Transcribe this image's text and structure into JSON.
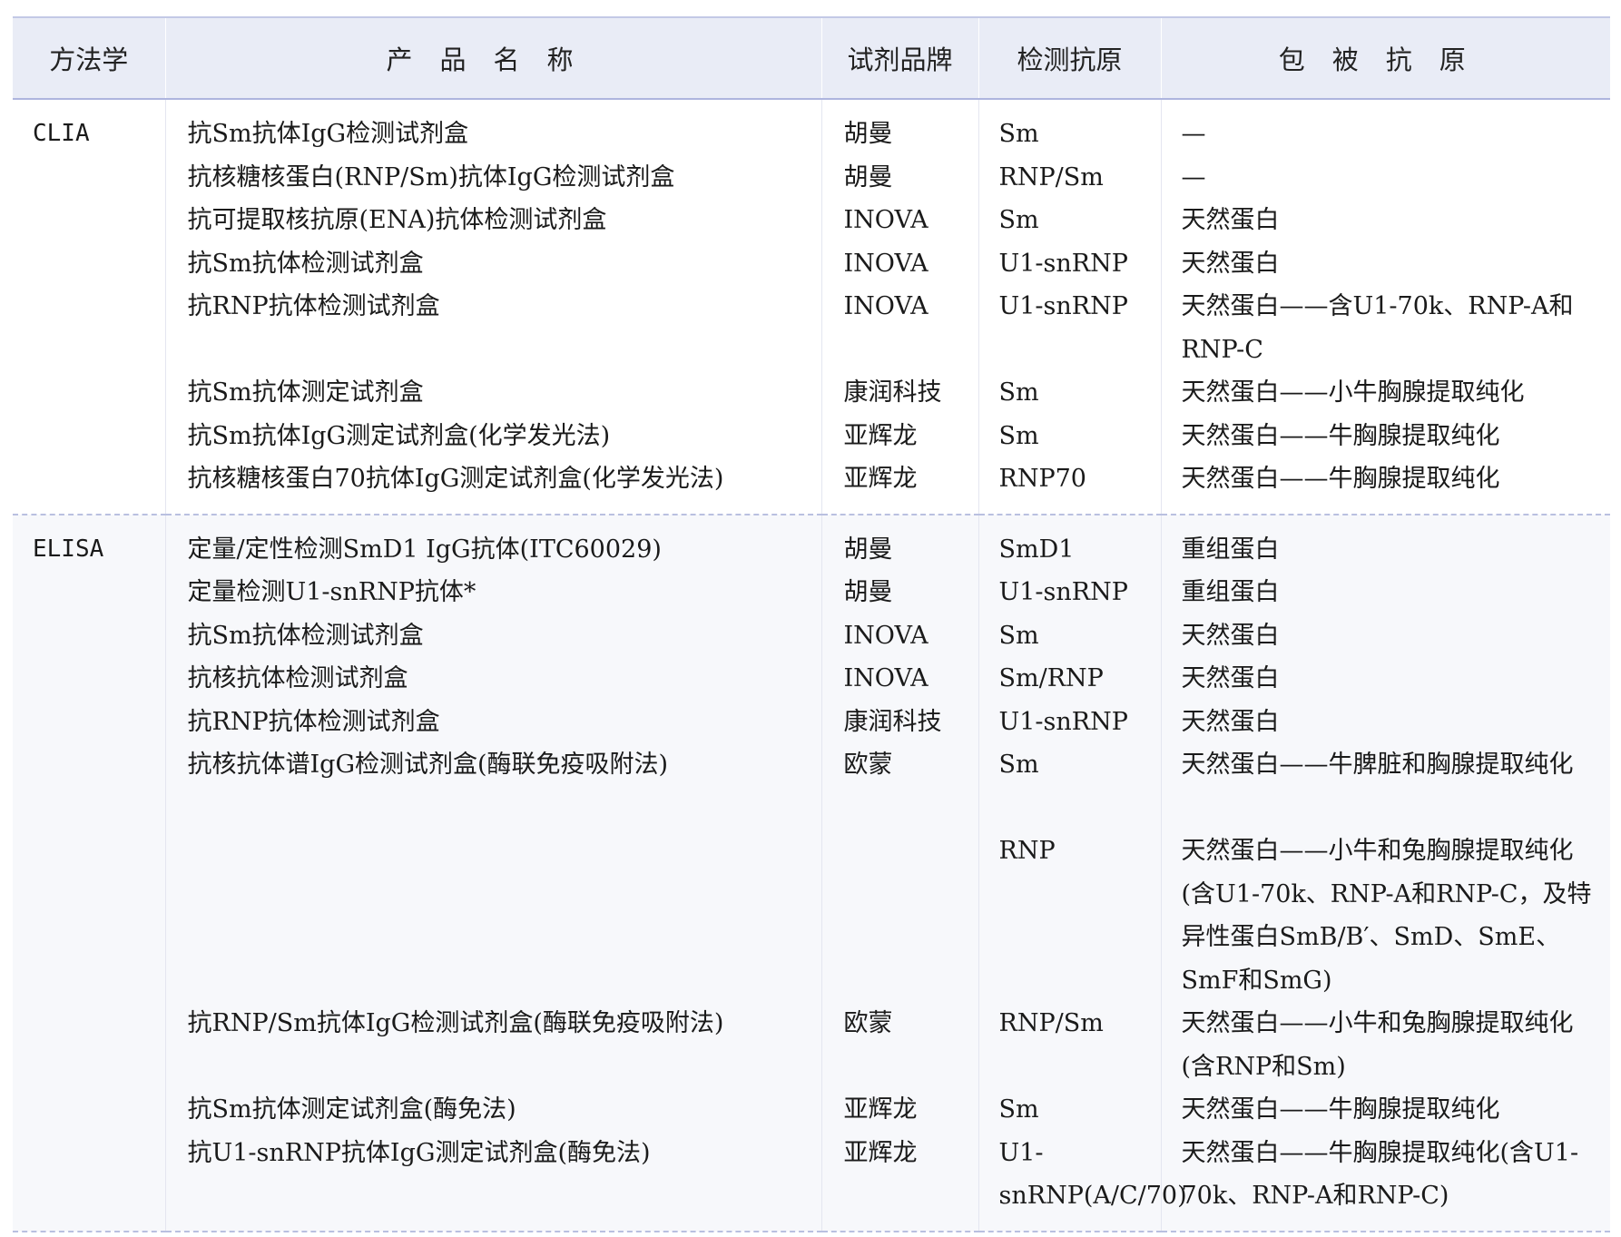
{
  "header": {
    "method": "方法学",
    "product": "产品名称",
    "brand": "试剂品牌",
    "antigen": "检测抗原",
    "coating": "包被抗原"
  },
  "groups": [
    {
      "method": "CLIA",
      "rows": [
        {
          "product": "抗Sm抗体IgG检测试剂盒",
          "brand": "胡曼",
          "antigen": "Sm",
          "coating": "—"
        },
        {
          "product": "抗核糖核蛋白(RNP/Sm)抗体IgG检测试剂盒",
          "brand": "胡曼",
          "antigen": "RNP/Sm",
          "coating": "—"
        },
        {
          "product": "抗可提取核抗原(ENA)抗体检测试剂盒",
          "brand": "INOVA",
          "antigen": "Sm",
          "coating": "天然蛋白"
        },
        {
          "product": "抗Sm抗体检测试剂盒",
          "brand": "INOVA",
          "antigen": "U1-snRNP",
          "coating": "天然蛋白"
        },
        {
          "product": "抗RNP抗体检测试剂盒",
          "brand": "INOVA",
          "antigen": "U1-snRNP",
          "coating": "天然蛋白——含U1-70k、RNP-A和RNP-C"
        },
        {
          "product": "抗Sm抗体测定试剂盒",
          "brand": "康润科技",
          "antigen": "Sm",
          "coating": "天然蛋白——小牛胸腺提取纯化"
        },
        {
          "product": "抗Sm抗体IgG测定试剂盒(化学发光法)",
          "brand": "亚辉龙",
          "antigen": "Sm",
          "coating": "天然蛋白——牛胸腺提取纯化"
        },
        {
          "product": "抗核糖核蛋白70抗体IgG测定试剂盒(化学发光法)",
          "brand": "亚辉龙",
          "antigen": "RNP70",
          "coating": "天然蛋白——牛胸腺提取纯化"
        }
      ]
    },
    {
      "method": "ELISA",
      "rows": [
        {
          "product": "定量/定性检测SmD1 IgG抗体(ITC60029)",
          "brand": "胡曼",
          "antigen": "SmD1",
          "coating": "重组蛋白"
        },
        {
          "product": "定量检测U1-snRNP抗体*",
          "brand": "胡曼",
          "antigen": "U1-snRNP",
          "coating": "重组蛋白"
        },
        {
          "product": "抗Sm抗体检测试剂盒",
          "brand": "INOVA",
          "antigen": "Sm",
          "coating": "天然蛋白"
        },
        {
          "product": "抗核抗体检测试剂盒",
          "brand": "INOVA",
          "antigen": "Sm/RNP",
          "coating": "天然蛋白"
        },
        {
          "product": "抗RNP抗体检测试剂盒",
          "brand": "康润科技",
          "antigen": "U1-snRNP",
          "coating": "天然蛋白"
        },
        {
          "product": "抗核抗体谱IgG检测试剂盒(酶联免疫吸附法)",
          "brand": "欧蒙",
          "antigen": "Sm",
          "coating": "天然蛋白——牛脾脏和胸腺提取纯化"
        },
        {
          "product": "",
          "brand": "",
          "antigen": "RNP",
          "coating": "天然蛋白——小牛和兔胸腺提取纯化(含U1-70k、RNP-A和RNP-C，及特异性蛋白SmB/B′、SmD、SmE、SmF和SmG)"
        },
        {
          "product": "抗RNP/Sm抗体IgG检测试剂盒(酶联免疫吸附法)",
          "brand": "欧蒙",
          "antigen": "RNP/Sm",
          "coating": "天然蛋白——小牛和兔胸腺提取纯化(含RNP和Sm)"
        },
        {
          "product": "抗Sm抗体测定试剂盒(酶免法)",
          "brand": "亚辉龙",
          "antigen": "Sm",
          "coating": "天然蛋白——牛胸腺提取纯化"
        },
        {
          "product": "抗U1-snRNP抗体IgG测定试剂盒(酶免法)",
          "brand": "亚辉龙",
          "antigen": "U1-snRNP(A/C/70)",
          "coating": "天然蛋白——牛胸腺提取纯化(含U1-70k、RNP-A和RNP-C)"
        }
      ]
    }
  ]
}
